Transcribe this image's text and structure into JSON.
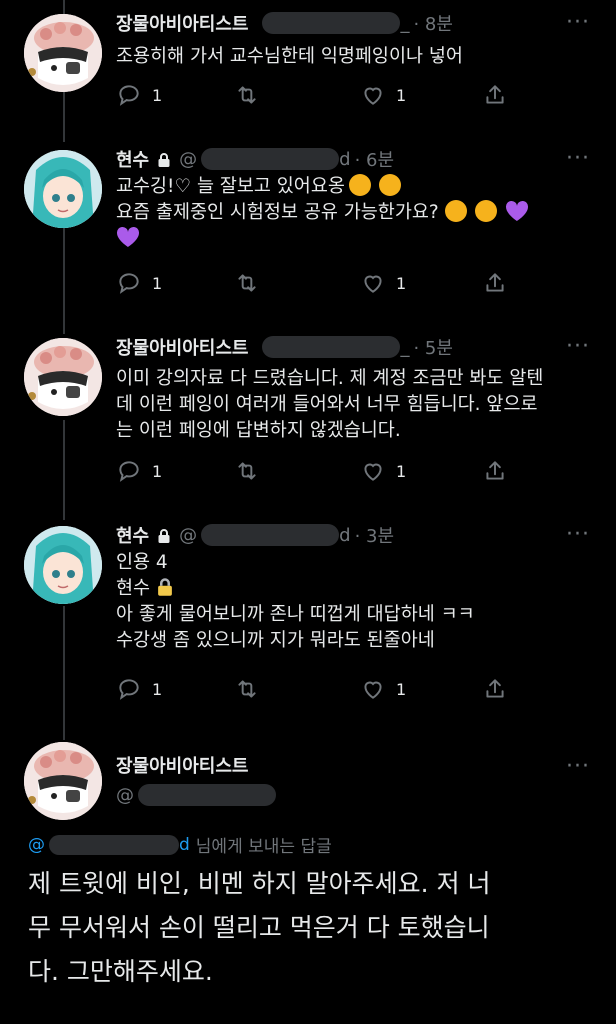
{
  "tweets": [
    {
      "name": "장물아비아티스트",
      "time": "· 8분",
      "lines": [
        "조용히해 가서 교수님한테 익명페잉이나 넣어"
      ],
      "replies": "1",
      "likes": "1"
    },
    {
      "name": "현수",
      "handle_prefix": "@",
      "handle_tail": "d",
      "time": "· 6분",
      "lines": [
        "교수깅!♡ 늘 잘보고 있어요옹",
        "요즘 출제중인 시험정보 공유 가능한가요?"
      ],
      "replies": "1",
      "likes": "1"
    },
    {
      "name": "장물아비아티스트",
      "time": "· 5분",
      "lines": [
        "이미 강의자료 다 드렸습니다. 제 계정 조금만 봐도 알텐",
        "데 이런 페잉이 여러개 들어와서 너무 힘듭니다. 앞으로",
        "는 이런 페잉에 답변하지 않겠습니다."
      ],
      "replies": "1",
      "likes": "1"
    },
    {
      "name": "현수",
      "handle_prefix": "@",
      "handle_tail": "d",
      "time": "· 3분",
      "lines": [
        "인용 4",
        "현수",
        "아 좋게 물어보니까 존나 띠껍게 대답하네 ㅋㅋ",
        "수강생 좀 있으니까 지가 뭐라도 된줄아네"
      ],
      "replies": "1",
      "likes": "1"
    }
  ],
  "main": {
    "name": "장물아비아티스트",
    "handle_prefix": "@",
    "reply_to_prefix": "@",
    "reply_to_tail": "d",
    "reply_to_suffix": "님에게 보내는 답글",
    "text_lines": [
      "제 트윗에 비인, 비멘 하지 말아주세요. 저 너",
      "무 무서워서 손이 떨리고 먹은거 다 토했습니",
      "다. 그만해주세요."
    ]
  },
  "colors": {
    "background": "#000000",
    "text": "#e7e9ea",
    "muted": "#71767b",
    "link": "#1d9bf0"
  },
  "icons": [
    "reply-icon",
    "retweet-icon",
    "like-icon",
    "share-icon",
    "lock-icon",
    "more-icon"
  ]
}
